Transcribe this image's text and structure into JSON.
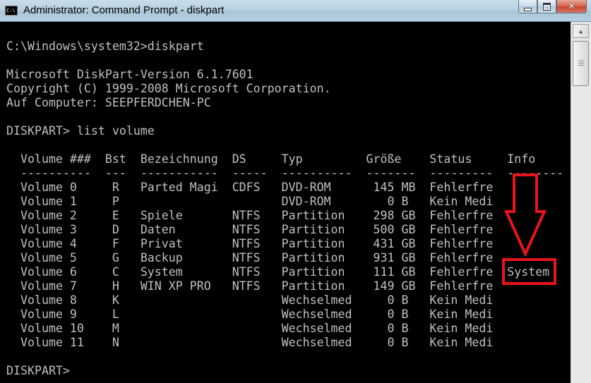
{
  "window": {
    "title": "Administrator: Command Prompt - diskpart",
    "icon_text": "C:\\",
    "controls": {
      "minimize": "minimize",
      "maximize": "maximize",
      "close": "close"
    }
  },
  "console": {
    "lines": [
      "C:\\Windows\\system32>diskpart",
      "",
      "Microsoft DiskPart-Version 6.1.7601",
      "Copyright (C) 1999-2008 Microsoft Corporation.",
      "Auf Computer: SEEPFERDCHEN-PC",
      "",
      "DISKPART> list volume",
      "",
      "  Volume ###  Bst  Bezeichnung  DS     Typ         Größe    Status     Info",
      "  ----------  ---  -----------  -----  ----------  -------  ---------  --------",
      "  Volume 0     R   Parted Magi  CDFS   DVD-ROM      145 MB  Fehlerfre",
      "  Volume 1     P                       DVD-ROM        0 B   Kein Medi",
      "  Volume 2     E   Spiele       NTFS   Partition    298 GB  Fehlerfre",
      "  Volume 3     D   Daten        NTFS   Partition    500 GB  Fehlerfre",
      "  Volume 4     F   Privat       NTFS   Partition    431 GB  Fehlerfre",
      "  Volume 5     G   Backup       NTFS   Partition    931 GB  Fehlerfre",
      "  Volume 6     C   System       NTFS   Partition    111 GB  Fehlerfre  System",
      "  Volume 7     H   WIN XP PRO   NTFS   Partition    149 GB  Fehlerfre",
      "  Volume 8     K                       Wechselmed     0 B   Kein Medi",
      "  Volume 9     L                       Wechselmed     0 B   Kein Medi",
      "  Volume 10    M                       Wechselmed     0 B   Kein Medi",
      "  Volume 11    N                       Wechselmed     0 B   Kein Medi",
      "",
      "DISKPART> "
    ]
  },
  "annotation": {
    "color": "#e8141c",
    "target_text": "System"
  },
  "colors": {
    "console_bg": "#000000",
    "console_fg": "#c0c0c0",
    "close_red": "#c7432b",
    "titlebar": "#b8d1e1"
  }
}
